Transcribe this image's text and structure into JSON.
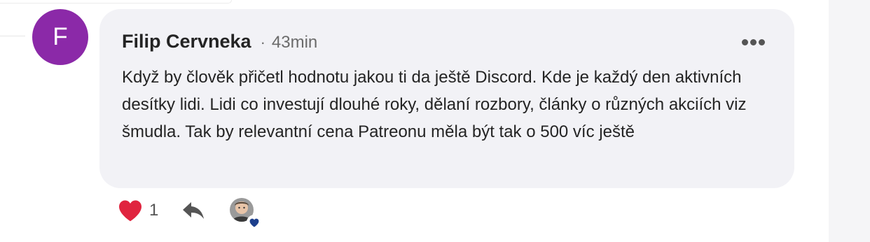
{
  "comment": {
    "author_initial": "F",
    "author_name": "Filip Cervneka",
    "separator": "·",
    "time_ago": "43min",
    "text": "Když by člověk přičetl hodnotu jakou ti da ještě Discord. Kde je každý den aktivních desítky lidi. Lidi co investují dlouhé roky, dělaní rozbory, články o různých akciích viz šmudla. Tak by relevantní cena Patreonu měla být tak o 500 víc ještě",
    "like_count": "1",
    "reactions": [
      {
        "type": "heart",
        "icon": "heart-badge-icon"
      }
    ]
  },
  "colors": {
    "avatar_bg": "#8b29a8",
    "bubble_bg": "#f2f2f6",
    "like_heart": "#e0243f",
    "reaction_heart": "#1c3f8c",
    "side_panel": "#f5f5f7"
  },
  "icons": {
    "more": "more-dots-icon",
    "like": "heart-icon",
    "reply": "reply-arrow-icon"
  }
}
